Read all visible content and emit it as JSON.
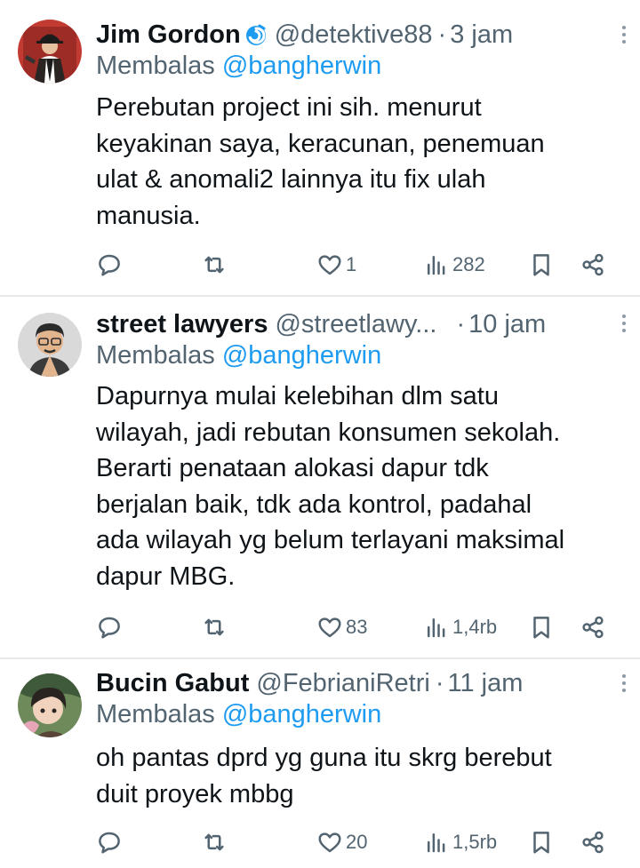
{
  "tweets": [
    {
      "name": "Jim Gordon",
      "handle": "@detektive88",
      "separator": "·",
      "time": "3 jam",
      "reply_prefix": "Membalas",
      "reply_to": "@bangherwin",
      "lines": [
        "Perebutan project ini sih.  menurut",
        "keyakinan saya, keracunan, penemuan",
        "ulat & anomali2 lainnya itu fix ulah",
        "manusia."
      ],
      "replies": "",
      "retweets": "",
      "likes": "1",
      "views": "282"
    },
    {
      "name": "street lawyers",
      "handle": "@streetlawy...",
      "separator": "·",
      "time": "10 jam",
      "reply_prefix": "Membalas",
      "reply_to": "@bangherwin",
      "lines": [
        "Dapurnya mulai kelebihan dlm satu",
        "wilayah, jadi rebutan konsumen sekolah.",
        "Berarti penataan alokasi dapur tdk",
        "berjalan baik, tdk ada kontrol, padahal",
        "ada wilayah yg belum terlayani maksimal",
        "dapur MBG."
      ],
      "replies": "",
      "retweets": "",
      "likes": "83",
      "views": "1,4rb"
    },
    {
      "name": "Bucin Gabut",
      "handle": "@FebrianiRetri",
      "separator": "·",
      "time": "11 jam",
      "reply_prefix": "Membalas",
      "reply_to": "@bangherwin",
      "lines": [
        "oh pantas dprd yg guna itu skrg berebut",
        "duit proyek mbbg"
      ],
      "replies": "",
      "retweets": "",
      "likes": "20",
      "views": "1,5rb"
    }
  ],
  "icons": {
    "reply": "comment-icon",
    "retweet": "retweet-icon",
    "like": "heart-icon",
    "views": "analytics-icon",
    "bookmark": "bookmark-icon",
    "share": "share-icon",
    "more": "more-vertical-icon",
    "verified": "spiral-badge-icon"
  },
  "colors": {
    "text": "#0f1419",
    "secondary": "#536471",
    "link": "#1d9bf0",
    "divider": "#e7e9ec",
    "badge": "#1d9bf0"
  }
}
